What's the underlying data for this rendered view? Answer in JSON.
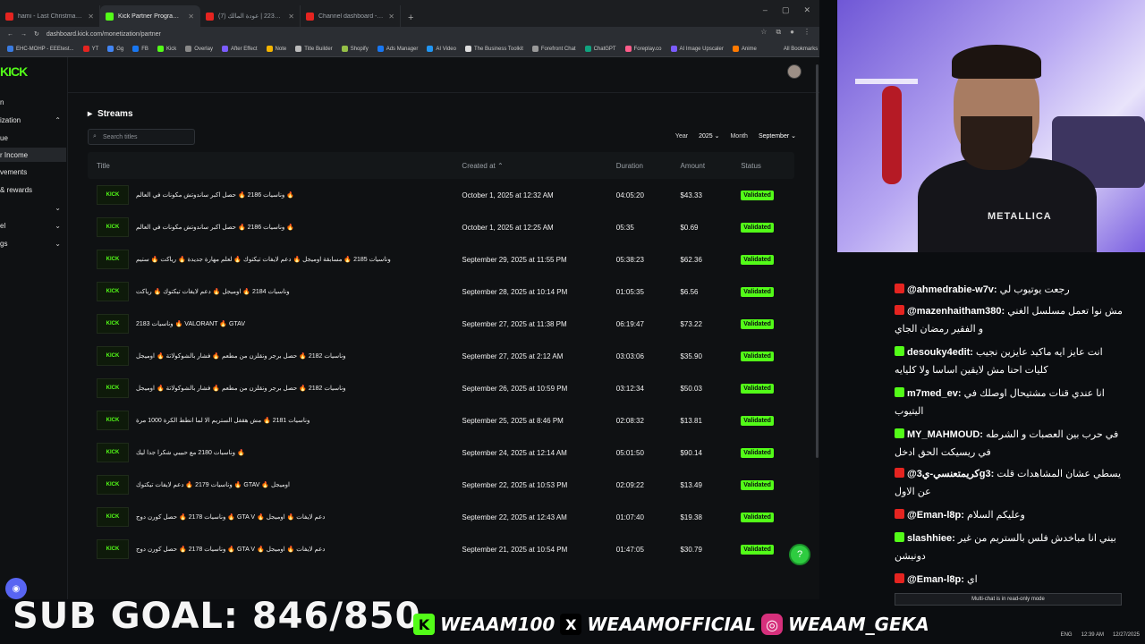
{
  "browser": {
    "tabs": [
      {
        "label": "hami - Last Christmas (Lyr",
        "color": "#e52420"
      },
      {
        "label": "Kick Partner Program - Kick Da",
        "color": "#53fc18",
        "active": true
      },
      {
        "label": "(7) وناسيات 2236 | عودة المالك",
        "color": "#e52420"
      },
      {
        "label": "Channel dashboard - YouTube",
        "color": "#e52420"
      }
    ],
    "url": "dashboard.kick.com/monetization/partner",
    "bookmarks": [
      "EHC-MOHP - EEEtest...",
      "YT",
      "Gg",
      "FB",
      "Kick",
      "Overlay",
      "After Effect",
      "Note",
      "Title Builder",
      "Shopify",
      "Ads Manager",
      "AI Video",
      "The Business Toolkit",
      "Forefront Chat",
      "ChatGPT",
      "Foreplay.co",
      "AI Image Upscaler",
      "Anime"
    ],
    "all_bookmarks": "All Bookmarks"
  },
  "sidebar": {
    "logo": "KICK",
    "items": [
      {
        "label": "n",
        "chevron": ""
      },
      {
        "label": "ization",
        "chevron": "⌃"
      },
      {
        "label": "ue",
        "chevron": ""
      },
      {
        "label": "r Income",
        "chevron": "",
        "active": true
      },
      {
        "label": "vements",
        "chevron": ""
      },
      {
        "label": "& rewards",
        "chevron": ""
      },
      {
        "label": "",
        "chevron": "⌄"
      },
      {
        "label": "el",
        "chevron": "⌄"
      },
      {
        "label": "gs",
        "chevron": "⌄"
      }
    ]
  },
  "streams": {
    "heading": "Streams",
    "search_placeholder": "Search titles",
    "year_label": "Year",
    "year_value": "2025",
    "month_label": "Month",
    "month_value": "September",
    "columns": {
      "title": "Title",
      "created": "Created at",
      "duration": "Duration",
      "amount": "Amount",
      "status": "Status"
    },
    "rows": [
      {
        "title": "وناسيات 2186 🔥 حصل اكبر ساندوتش مكونات في العالم 🔥",
        "created": "October 1, 2025 at 12:32 AM",
        "duration": "04:05:20",
        "amount": "$43.33",
        "status": "Validated"
      },
      {
        "title": "وناسيات 2186 🔥 حصل اكبر ساندوتش مكونات في العالم 🔥",
        "created": "October 1, 2025 at 12:25 AM",
        "duration": "05:35",
        "amount": "$0.69",
        "status": "Validated"
      },
      {
        "title": "وناسيات 2185 🔥 مسابقة اوميجل 🔥 دعم لايفات تيكتوك 🔥 لعلم مهارة جديدة 🔥 رياكت 🔥 ستيم",
        "created": "September 29, 2025 at 11:55 PM",
        "duration": "05:38:23",
        "amount": "$62.36",
        "status": "Validated"
      },
      {
        "title": "وناسيات 2184 🔥 اوميجل 🔥 دعم لايفات تيكتوك 🔥 رياكت",
        "created": "September 28, 2025 at 10:14 PM",
        "duration": "01:05:35",
        "amount": "$6.56",
        "status": "Validated"
      },
      {
        "title": "وناسيات 2183 🔥 VALORANT 🔥 GTAV",
        "created": "September 27, 2025 at 11:38 PM",
        "duration": "06:19:47",
        "amount": "$73.22",
        "status": "Validated"
      },
      {
        "title": "وناسيات 2182 🔥 حصل برجر ونقلزن من مطعم 🔥 فشار بالشوكولاتة 🔥 اوميجل",
        "created": "September 27, 2025 at 2:12 AM",
        "duration": "03:03:06",
        "amount": "$35.90",
        "status": "Validated"
      },
      {
        "title": "وناسيات 2182 🔥 حصل برجر ونقلزن من مطعم 🔥 فشار بالشوكولاتة 🔥 اوميجل",
        "created": "September 26, 2025 at 10:59 PM",
        "duration": "03:12:34",
        "amount": "$50.03",
        "status": "Validated"
      },
      {
        "title": "وناسيات 2181 🔥 مش هقفل الستريم الا لما انطط الكرة 1000 مرة",
        "created": "September 25, 2025 at 8:46 PM",
        "duration": "02:08:32",
        "amount": "$13.81",
        "status": "Validated"
      },
      {
        "title": "وناسيات 2180 مع حبيبي شكرا جدا ليك 🔥",
        "created": "September 24, 2025 at 12:14 AM",
        "duration": "05:01:50",
        "amount": "$90.14",
        "status": "Validated"
      },
      {
        "title": "وناسيات 2179 🔥 دعم لايفات تيكتوك 🔥 GTAV 🔥 اوميجل",
        "created": "September 22, 2025 at 10:53 PM",
        "duration": "02:09:22",
        "amount": "$13.49",
        "status": "Validated"
      },
      {
        "title": "وناسيات 2178 🔥 حصل كورن دوج 🔥 GTA V 🔥 دعم لايفات 🔥 اوميجل",
        "created": "September 22, 2025 at 12:43 AM",
        "duration": "01:07:40",
        "amount": "$19.38",
        "status": "Validated"
      },
      {
        "title": "وناسيات 2178 🔥 حصل كورن دوج 🔥 GTA V 🔥 دعم لايفات 🔥 اوميجل",
        "created": "September 21, 2025 at 10:54 PM",
        "duration": "01:47:05",
        "amount": "$30.79",
        "status": "Validated"
      }
    ]
  },
  "chat": {
    "messages": [
      {
        "platform": "yt",
        "user": "@ahmedrabie-w7v:",
        "text": "رجعت يوتيوب لي"
      },
      {
        "platform": "yt",
        "user": "@mazenhaitham380:",
        "text": "مش نوا تعمل مسلسل الغني و الفقير رمضان الجاي"
      },
      {
        "platform": "kick",
        "user": "desouky4edit:",
        "text": "انت عايز ايه ماكيد عايزين نجيب كليات احنا مش لايقين اساسا ولا كليايه"
      },
      {
        "platform": "kick",
        "user": "m7med_ev:",
        "text": "انا عندي قنات مشتيحال اوصلك في اليتيوب"
      },
      {
        "platform": "kick",
        "user": "MY_MAHMOUD:",
        "text": "في حرب بين العصبات و الشرطه في ريسيكت الحق ادخل"
      },
      {
        "platform": "yt",
        "user": "@كريمتعنسي-ي3g3:",
        "text": "يسطي عشان المشاهدات قلت عن الاول"
      },
      {
        "platform": "yt",
        "user": "@Eman-l8p:",
        "text": "وعليكم السلام"
      },
      {
        "platform": "kick",
        "user": "slashhiee:",
        "text": "بيني انا مباخدش فلس بالستريم من غير دونيشن"
      },
      {
        "platform": "yt",
        "user": "@Eman-l8p:",
        "text": "اي"
      }
    ],
    "readonly_notice": "Multi-chat is in read-only mode"
  },
  "overlay": {
    "sub_goal": "SUB GOAL: 846/850",
    "kick_handle": "WEAAM100",
    "x_handle": "WEAAMOFFICIAL",
    "ig_handle": "WEAAM_GEKA"
  },
  "taskbar": {
    "lang": "ENG",
    "time": "12:39 AM",
    "date": "12/27/2025"
  }
}
